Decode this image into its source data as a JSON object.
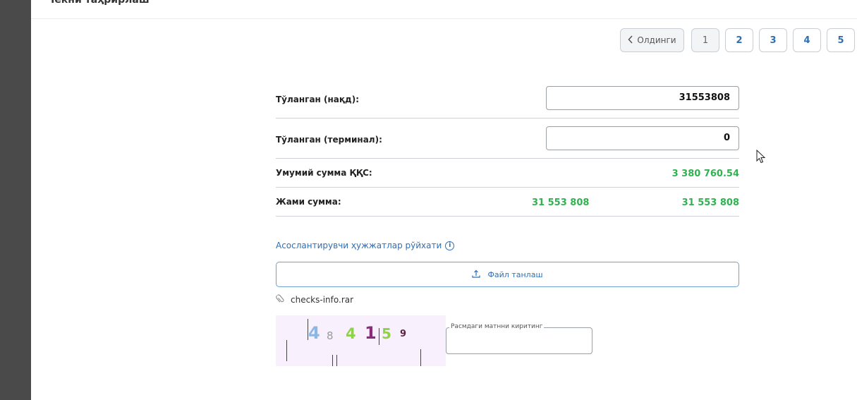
{
  "header": {
    "title": "Чекни таҳрирлаш"
  },
  "pagination": {
    "prev_label": "Олдинги",
    "pages": [
      "1",
      "2",
      "3",
      "4",
      "5"
    ],
    "active_page": "1"
  },
  "summary": {
    "paid_cash": {
      "label": "Тўланган (нақд):",
      "value": "31553808"
    },
    "paid_terminal": {
      "label": "Тўланган (терминал):",
      "value": "0"
    },
    "vat_total": {
      "label": "Умумий сумма ҚҚС:",
      "value": "3 380 760.54"
    },
    "grand_total": {
      "label": "Жами сумма:",
      "value_left": "31 553 808",
      "value_right": "31 553 808"
    }
  },
  "documents": {
    "link_label": "Асослантирувчи ҳужжатлар рўйхати",
    "upload_label": "Файл танлаш",
    "file_name": "checks-info.rar"
  },
  "captcha": {
    "chars": [
      "4",
      "8",
      "4",
      "1",
      "5",
      "9"
    ],
    "input_label": "Расмдаги матнни киритинг",
    "input_value": ""
  },
  "colors": {
    "accent": "#2f6fb5",
    "positive": "#2fb24f",
    "rail": "#4a4a4a"
  }
}
